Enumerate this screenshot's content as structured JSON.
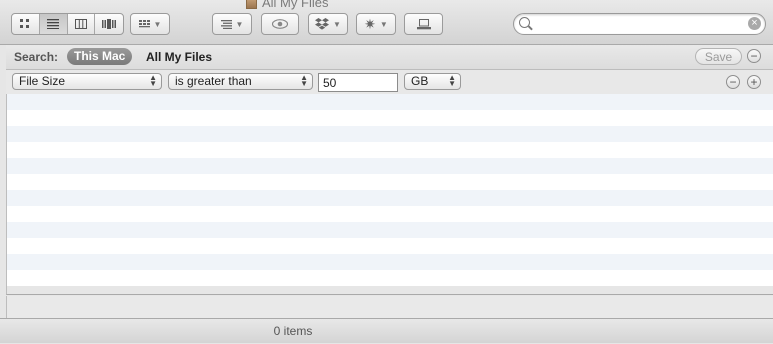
{
  "window": {
    "title": "All My Files"
  },
  "toolbar": {
    "view_modes": [
      "icon-view",
      "list-view",
      "column-view",
      "cover-flow-view"
    ],
    "active_view": "list-view",
    "arrange_icon": "arrange-menu-icon",
    "sort_icon": "sort-menu-icon",
    "quicklook_icon": "eye-icon",
    "dropbox_icon": "dropbox-icon",
    "action_icon": "gear-icon",
    "connect_icon": "connect-server-icon",
    "search_value": "",
    "search_placeholder": ""
  },
  "scope": {
    "label": "Search:",
    "selected": "This Mac",
    "other": "All My Files",
    "save_label": "Save"
  },
  "criteria": {
    "attribute": "File Size",
    "operator": "is greater than",
    "value": "50",
    "unit": "GB"
  },
  "status": {
    "items": "0 items"
  }
}
